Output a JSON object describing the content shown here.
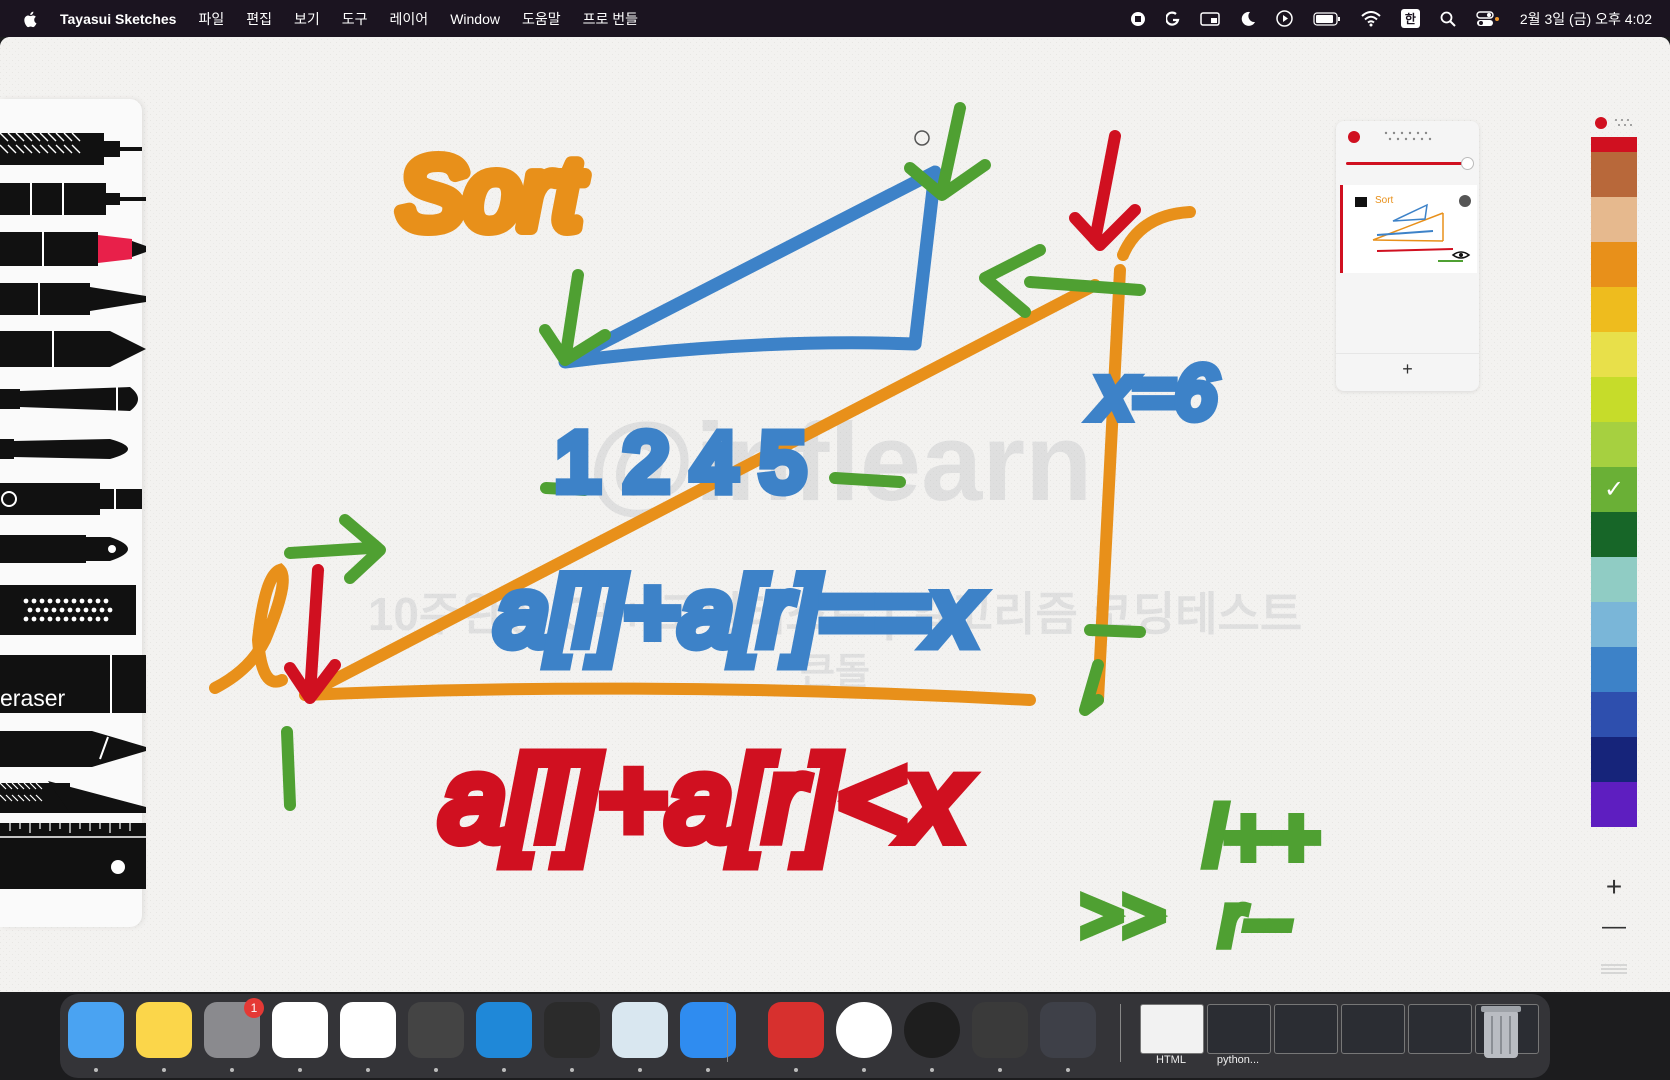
{
  "menubar": {
    "app_name": "Tayasui Sketches",
    "items": [
      "파일",
      "편집",
      "보기",
      "도구",
      "레이어",
      "Window",
      "도움말",
      "프로 번들"
    ],
    "ime": "한",
    "clock": "2월 3일 (금) 오후 4:02"
  },
  "window": {
    "traffic_colors": [
      "#ff5f57",
      "#febc2e",
      "#28c840"
    ]
  },
  "tools": {
    "eraser_label": "eraser"
  },
  "canvas": {
    "title": "Sort",
    "texts": {
      "x_eq_6": "x=6",
      "sum_eq": "a[l]+a[r]==x",
      "sum_lt": "a[l]+a[r]<x",
      "l_incr": "l++",
      "r_decr": "r--",
      "shift": ">>",
      "num_1": "1",
      "l_label": "l",
      "r_label": "r",
      "nums_top": "1 2 4 5"
    },
    "watermark": {
      "brand": "@inflearn",
      "course": "10주완성 C++ 코딩테스트 | 알고리즘 코딩테스트",
      "sub": "큰돌"
    }
  },
  "layers": {
    "add_label": "+"
  },
  "palette": {
    "colors": [
      "#d01020",
      "#b8683a",
      "#e6b98e",
      "#e8901a",
      "#eebc1e",
      "#e8e04a",
      "#c6dc2a",
      "#a6d040",
      "#6ab036",
      "#176628",
      "#90ccc4",
      "#7ab6d8",
      "#3d82c8",
      "#2e4fae",
      "#16247a",
      "#5e1ec0"
    ],
    "selected_index": 8,
    "plus": "+",
    "minus": "—"
  },
  "dock": {
    "apps": [
      {
        "name": "Finder",
        "color": "#4aa3f2"
      },
      {
        "name": "Notes",
        "color": "#fbd64a"
      },
      {
        "name": "System Settings",
        "color": "#8a8a8e",
        "badge": "1"
      },
      {
        "name": "Chrome",
        "color": "#ffffff"
      },
      {
        "name": "Tayasui Sketches",
        "color": "#ffffff"
      },
      {
        "name": "Calculator",
        "color": "#444444"
      },
      {
        "name": "VS Code",
        "color": "#1f88d8"
      },
      {
        "name": "Terminal",
        "color": "#2b2b2b"
      },
      {
        "name": "Preview",
        "color": "#d9e7f0"
      },
      {
        "name": "Keynote",
        "color": "#2f8cf0"
      },
      {
        "name": "Acrobat",
        "color": "#d7302e"
      },
      {
        "name": "Whale",
        "color": "#ffffff"
      },
      {
        "name": "Zoom",
        "color": "#1e1e1e"
      },
      {
        "name": "Final Cut Pro",
        "color": "#3a3a3a"
      },
      {
        "name": "QuickTime",
        "color": "#3e4048"
      }
    ],
    "docs": [
      {
        "label": "HTML"
      },
      {
        "label": "python..."
      },
      {
        "label": ""
      },
      {
        "label": ""
      },
      {
        "label": ""
      },
      {
        "label": ""
      }
    ]
  }
}
